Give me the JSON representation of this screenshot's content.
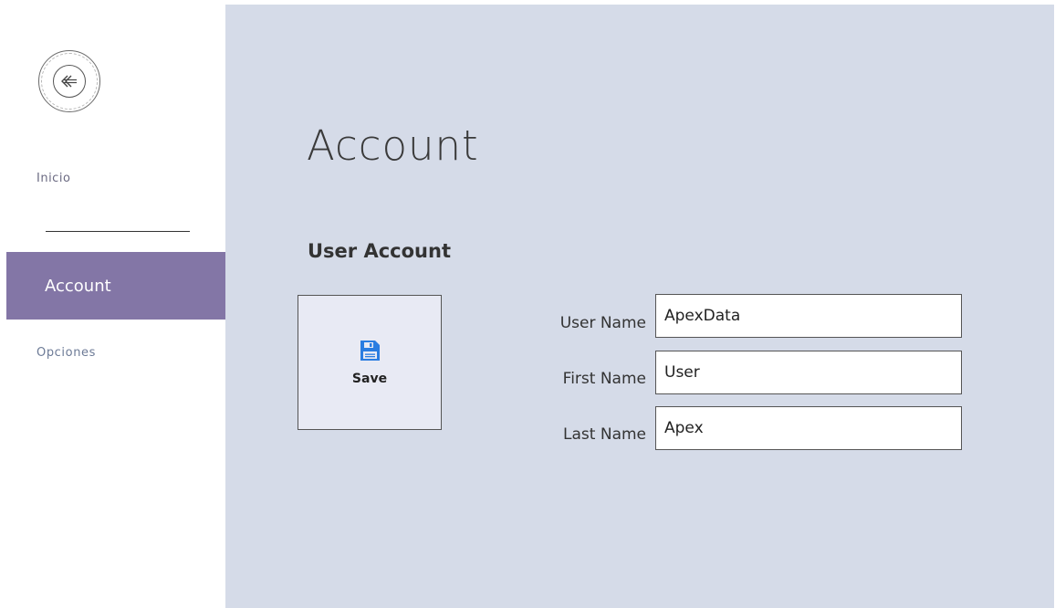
{
  "sidebar": {
    "back_icon": "back-arrow-icon",
    "items": [
      {
        "label": "Inicio"
      },
      {
        "label": "Account"
      },
      {
        "label": "Opciones"
      }
    ]
  },
  "main": {
    "title": "Account",
    "section_title": "User Account",
    "save": {
      "label": "Save",
      "icon": "floppy-disk-icon",
      "icon_color": "#2a7de1"
    },
    "fields": {
      "user_name": {
        "label": "User Name",
        "value": "ApexData"
      },
      "first_name": {
        "label": "First Name",
        "value": "User"
      },
      "last_name": {
        "label": "Last Name",
        "value": "Apex"
      }
    }
  },
  "colors": {
    "accent": "#8376a6",
    "main_background": "#d5dbe8"
  }
}
